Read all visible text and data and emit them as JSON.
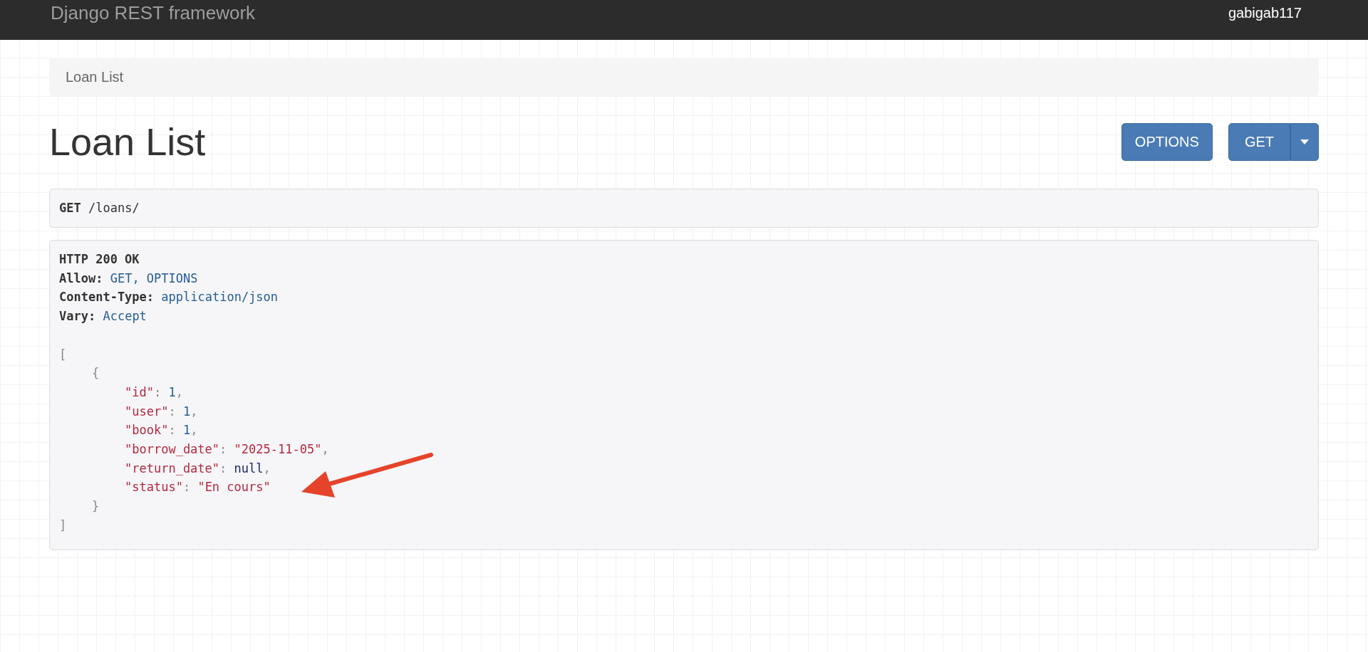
{
  "navbar": {
    "brand": "Django REST framework",
    "user": "gabigab117"
  },
  "breadcrumb": [
    {
      "label": "Loan List",
      "selected": true
    }
  ],
  "page_title": "Loan List",
  "buttons": {
    "options": "OPTIONS",
    "get": "GET"
  },
  "request": {
    "method": "GET",
    "path": "/loans/"
  },
  "response": {
    "status": "HTTP 200 OK",
    "headers": [
      {
        "name": "Allow:",
        "value": "GET, OPTIONS"
      },
      {
        "name": "Content-Type:",
        "value": "application/json"
      },
      {
        "name": "Vary:",
        "value": "Accept"
      }
    ],
    "body": {
      "open": "[",
      "close": "]",
      "items": [
        {
          "open": "{",
          "close": "}",
          "fields": [
            {
              "key": "\"id\"",
              "sep": ":",
              "value": "1",
              "kind": "number",
              "comma": ","
            },
            {
              "key": "\"user\"",
              "sep": ":",
              "value": "1",
              "kind": "number",
              "comma": ","
            },
            {
              "key": "\"book\"",
              "sep": ":",
              "value": "1",
              "kind": "number",
              "comma": ","
            },
            {
              "key": "\"borrow_date\"",
              "sep": ":",
              "value": "\"2025-11-05\"",
              "kind": "string",
              "comma": ","
            },
            {
              "key": "\"return_date\"",
              "sep": ":",
              "value": "null",
              "kind": "null",
              "comma": ","
            },
            {
              "key": "\"status\"",
              "sep": ":",
              "value": "\"En cours\"",
              "kind": "string"
            }
          ]
        }
      ]
    }
  }
}
